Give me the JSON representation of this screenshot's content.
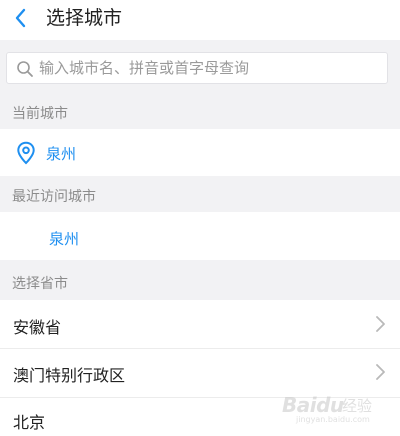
{
  "header": {
    "title": "选择城市",
    "back_icon": "chevron-left-icon"
  },
  "search": {
    "placeholder": "输入城市名、拼音或首字母查询",
    "value": "",
    "icon": "search-icon"
  },
  "current_city": {
    "section_title": "当前城市",
    "city": "泉州",
    "icon": "location-pin-icon"
  },
  "recent": {
    "section_title": "最近访问城市",
    "cities": [
      "泉州"
    ]
  },
  "provinces": {
    "section_title": "选择省市",
    "items": [
      {
        "label": "安徽省",
        "has_arrow": true
      },
      {
        "label": "澳门特别行政区",
        "has_arrow": true
      },
      {
        "label": "北京",
        "has_arrow": false
      }
    ]
  },
  "watermark": {
    "brand": "Baidu",
    "sub": "经验",
    "url": "jingyan.baidu.com"
  },
  "colors": {
    "accent": "#1e8ff0",
    "section_bg": "#f2f2f4",
    "section_text": "#8c8c8c",
    "text": "#222222",
    "chevron": "#b9b9b9"
  }
}
